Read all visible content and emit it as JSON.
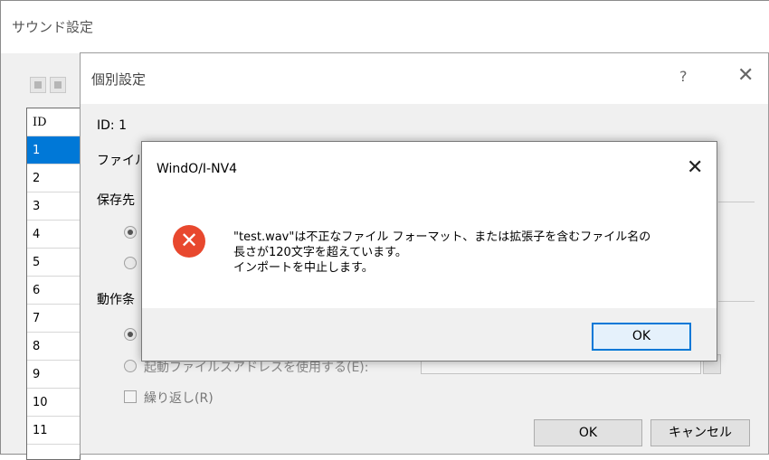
{
  "outer_window": {
    "title": "サウンド設定",
    "id_list": {
      "header": "ID",
      "rows": [
        "1",
        "2",
        "3",
        "4",
        "5",
        "6",
        "7",
        "8",
        "9",
        "10",
        "11"
      ],
      "selected": "1"
    }
  },
  "dialog": {
    "title": "個別設定",
    "help": "?",
    "close": "✕",
    "id_label": "ID: 1",
    "file_label": "ファイル",
    "save_label": "保存先",
    "action_label": "動作条",
    "radio_partial": "起動ファイルスアドレスを使用する(E):",
    "repeat_label": "繰り返し(R)",
    "ok": "OK",
    "cancel": "キャンセル"
  },
  "message_box": {
    "title": "WindO/I-NV4",
    "close": "✕",
    "icon": "error-icon",
    "line1": "\"test.wav\"は不正なファイル フォーマット、または拡張子を含むファイル名の",
    "line2": "長さが120文字を超えています。",
    "line3": "インポートを中止します。",
    "ok": "OK"
  },
  "colors": {
    "selection": "#0078d7",
    "error": "#e8482e",
    "default_button_border": "#0078d7"
  }
}
